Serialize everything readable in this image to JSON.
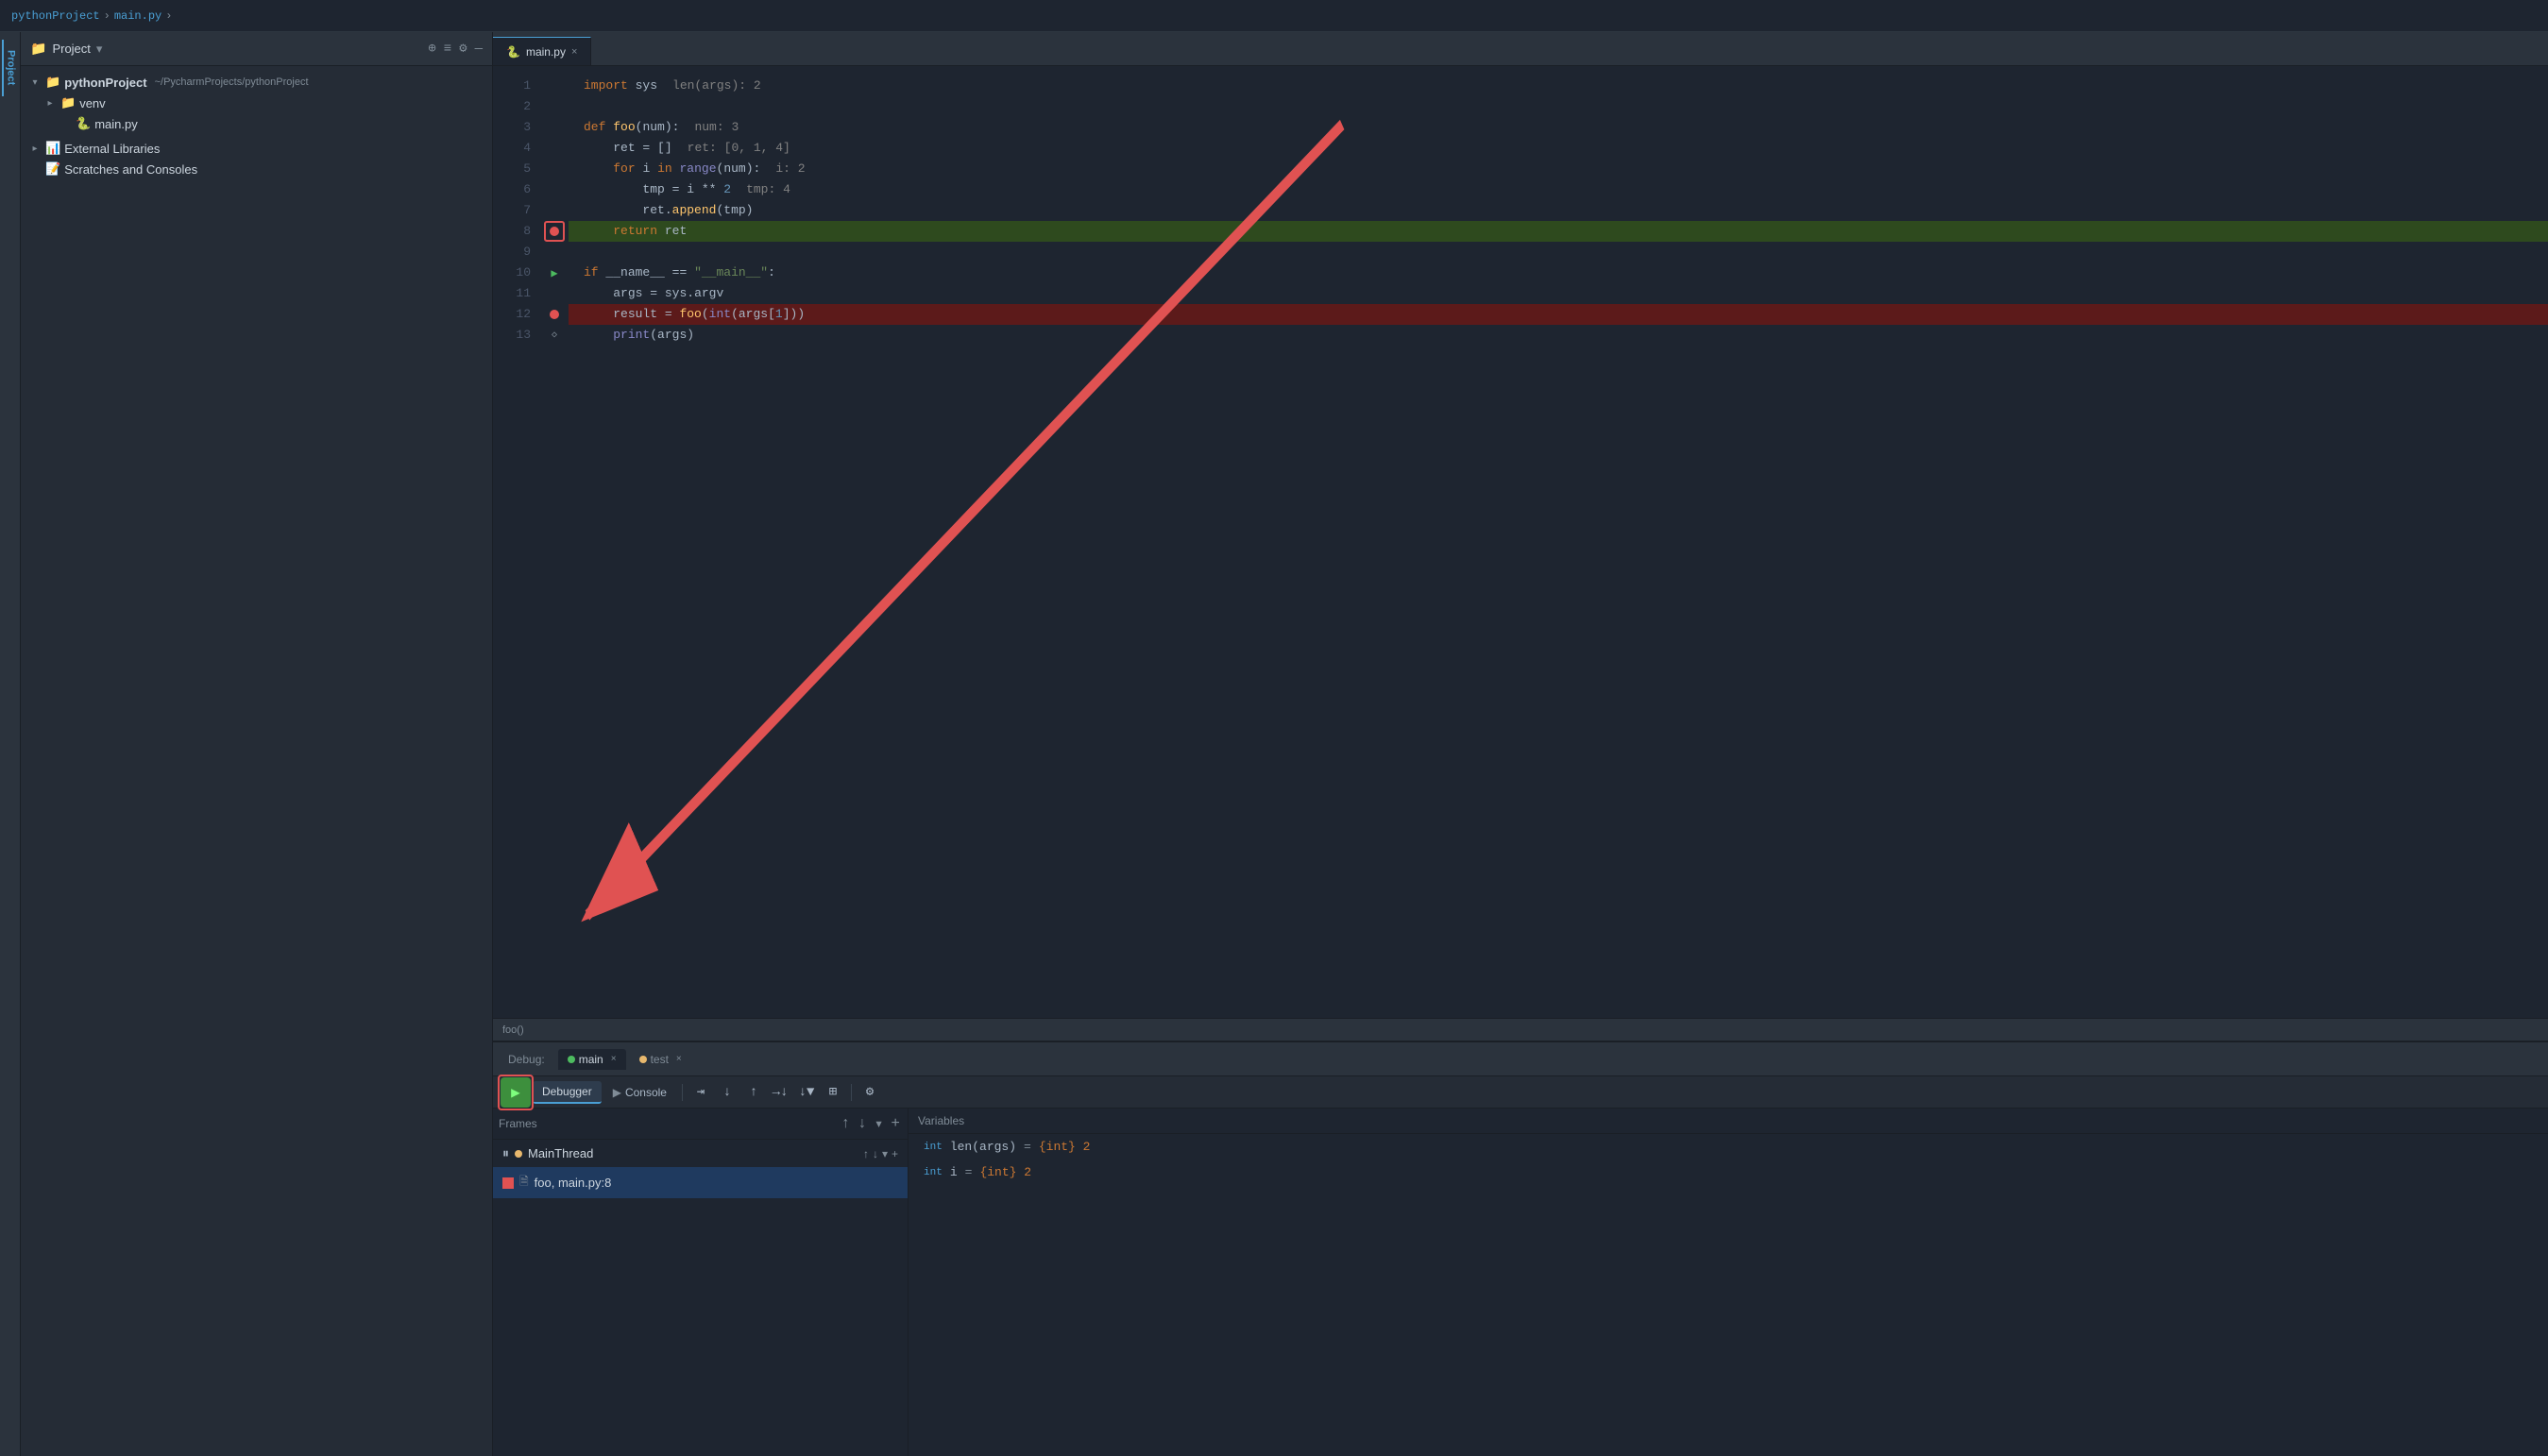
{
  "breadcrumb": {
    "project": "pythonProject",
    "sep1": "›",
    "file": "main.py",
    "sep2": "›"
  },
  "panel": {
    "title": "Project",
    "dropdown_arrow": "▾"
  },
  "tree": {
    "project_name": "pythonProject",
    "project_path": "~/PycharmProjects/pythonProject",
    "venv": "venv",
    "main_file": "main.py",
    "external_libraries": "External Libraries",
    "scratches": "Scratches and Consoles"
  },
  "editor": {
    "tab_name": "main.py",
    "status_bar_text": "foo()"
  },
  "code_lines": [
    {
      "num": 1,
      "text": "import sys",
      "inline_comment": "len(args): 2",
      "type": "normal"
    },
    {
      "num": 2,
      "text": "",
      "type": "normal"
    },
    {
      "num": 3,
      "text": "def foo(num):",
      "inline_comment": "num: 3",
      "type": "normal"
    },
    {
      "num": 4,
      "text": "    ret = []",
      "inline_comment": "ret: [0, 1, 4]",
      "type": "normal"
    },
    {
      "num": 5,
      "text": "    for i in range(num):",
      "inline_comment": "i: 2",
      "type": "normal"
    },
    {
      "num": 6,
      "text": "        tmp = i ** 2",
      "inline_comment": "tmp: 4",
      "type": "normal"
    },
    {
      "num": 7,
      "text": "        ret.append(tmp)",
      "type": "normal"
    },
    {
      "num": 8,
      "text": "    return ret",
      "type": "current"
    },
    {
      "num": 9,
      "text": "",
      "type": "normal"
    },
    {
      "num": 10,
      "text": "if __name__ == \"__main__\":",
      "type": "normal",
      "has_run_arrow": true
    },
    {
      "num": 11,
      "text": "    args = sys.argv",
      "type": "normal"
    },
    {
      "num": 12,
      "text": "    result = foo(int(args[1]))",
      "type": "breakpoint",
      "has_breakpoint": true
    },
    {
      "num": 13,
      "text": "    print(args)",
      "type": "normal",
      "has_step": true
    }
  ],
  "debug": {
    "label": "Debug:",
    "session1_name": "main",
    "session2_name": "test",
    "tabs": {
      "debugger": "Debugger",
      "console": "Console"
    },
    "toolbar_icons": [
      "≡",
      "↑↑",
      "↓",
      "↓→",
      "↑",
      "⊗",
      "⊞"
    ],
    "frames_header": "Frames",
    "variables_header": "Variables",
    "thread_name": "MainThread",
    "frame_name": "foo, main.py:8",
    "variables": [
      {
        "type": "int",
        "name": "len(args)",
        "value": "{int} 2"
      },
      {
        "type": "int",
        "name": "i",
        "value": "{int} 2"
      }
    ]
  },
  "icons": {
    "folder": "📁",
    "py_file": "🐍",
    "lib": "📚",
    "scratch": "📝",
    "settings": "⚙",
    "close": "×",
    "play": "▶",
    "stop": "■",
    "resume": "▶",
    "step_over": "↷",
    "step_into": "↓",
    "step_out": "↑",
    "run_to_cursor": "→",
    "evaluate": "⊞",
    "rerun": "↺"
  }
}
